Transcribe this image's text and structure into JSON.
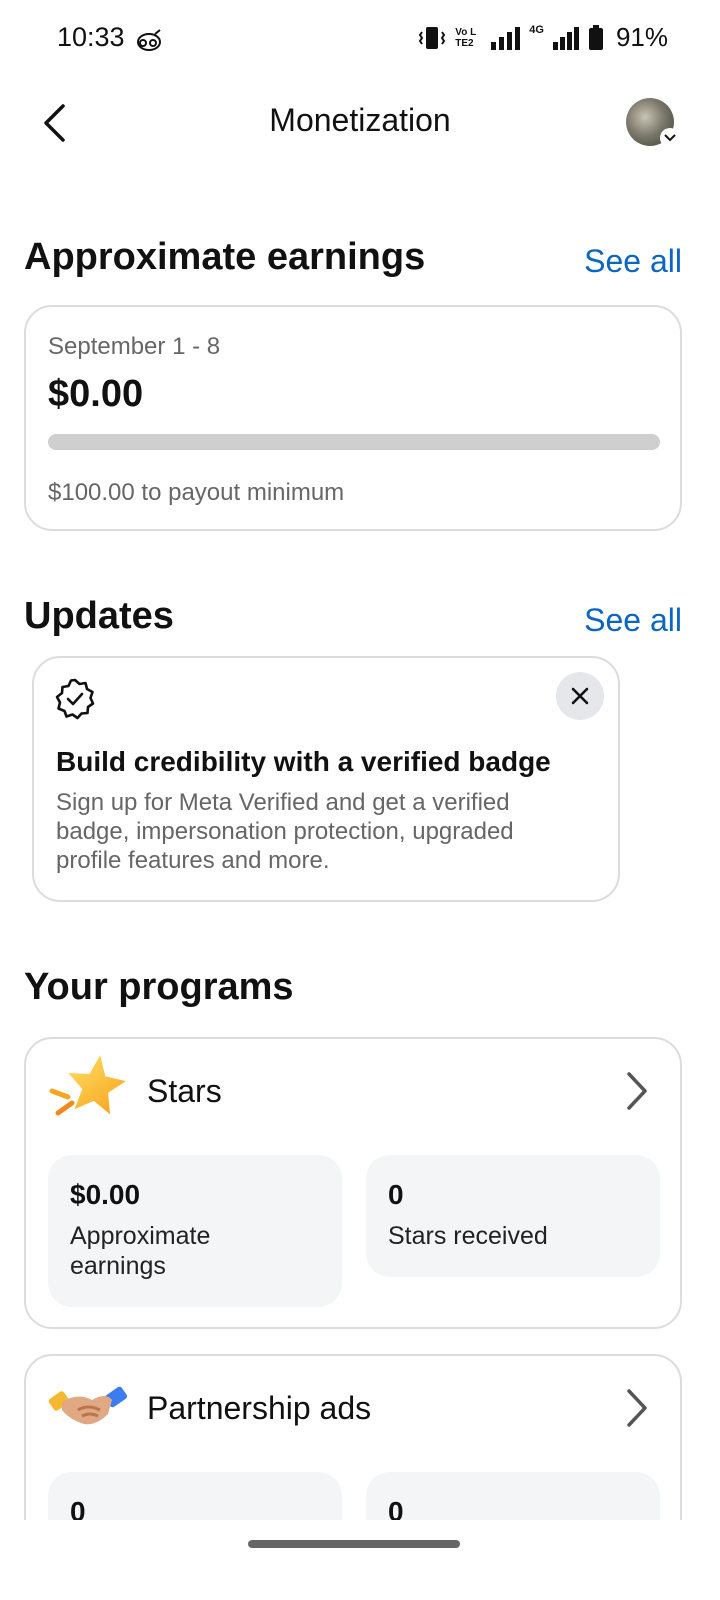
{
  "status_bar": {
    "time": "10:33",
    "battery_percent": "91%",
    "network_label": "4G",
    "volte_label": "Vo LTE2"
  },
  "header": {
    "title": "Monetization"
  },
  "earnings": {
    "section_title": "Approximate earnings",
    "see_all": "See all",
    "date_range": "September 1 - 8",
    "amount": "$0.00",
    "progress_fraction": 0,
    "payout_note": "$100.00 to payout minimum"
  },
  "updates": {
    "section_title": "Updates",
    "see_all": "See all",
    "card": {
      "title": "Build credibility with a verified badge",
      "body": "Sign up for Meta Verified and get a verified badge, impersonation protection, upgraded profile features and more."
    }
  },
  "programs": {
    "section_title": "Your programs",
    "stars": {
      "name": "Stars",
      "earnings_value": "$0.00",
      "earnings_label": "Approximate earnings",
      "received_value": "0",
      "received_label": "Stars received"
    },
    "partnership": {
      "name": "Partnership ads",
      "stat1_value": "0",
      "stat2_value": "0"
    }
  },
  "colors": {
    "accent": "#0a66c2",
    "muted_text": "#666666",
    "card_border": "#dcdcdc",
    "stat_bg": "#f4f5f7"
  },
  "icons": {
    "back": "chevron-left-icon",
    "verified": "verified-badge-icon",
    "close": "close-icon",
    "stars": "star-icon",
    "partnership": "handshake-icon",
    "chevron": "chevron-right-icon"
  }
}
